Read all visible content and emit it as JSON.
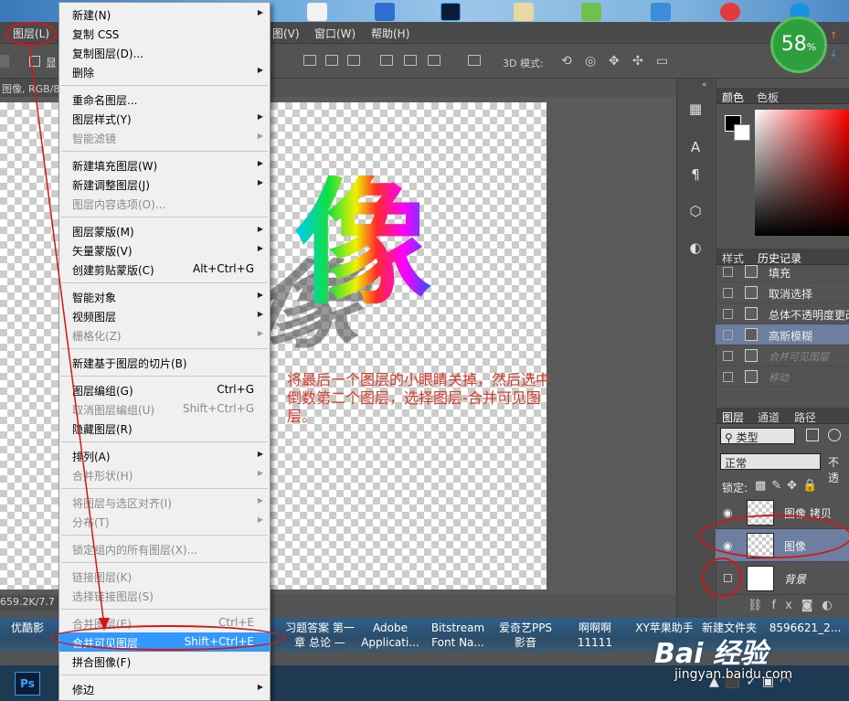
{
  "ps_menubar": {
    "layer": "图层(L)",
    "view": "图(V)",
    "window": "窗口(W)",
    "help": "帮助(H)"
  },
  "options_bar": {
    "mode_3d": "3D 模式:",
    "show": "显"
  },
  "document": {
    "tab": "图像, RGB/8)",
    "status": "659.2K/7.7"
  },
  "canvas": {
    "glyph": "像",
    "annotation": "将最后一个图层的小眼睛关掉，然后选中倒数第二个图层，选择图层-合并可见图层。"
  },
  "panels": {
    "color_tabs": [
      "颜色",
      "色板"
    ],
    "history_tabs": [
      "样式",
      "历史记录"
    ],
    "history": [
      {
        "label": "填充",
        "selected": false,
        "dimmed": false
      },
      {
        "label": "取消选择",
        "selected": false,
        "dimmed": false
      },
      {
        "label": "总体不透明度更改",
        "selected": false,
        "dimmed": false
      },
      {
        "label": "高斯模糊",
        "selected": true,
        "dimmed": false
      },
      {
        "label": "合并可见图层",
        "selected": false,
        "dimmed": true
      },
      {
        "label": "移动",
        "selected": false,
        "dimmed": true
      }
    ],
    "layer_tabs": [
      "图层",
      "通道",
      "路径"
    ],
    "filter_kind": "类型",
    "blend_mode": "正常",
    "opacity_label": "不透",
    "lock_label": "锁定:",
    "layers": [
      {
        "name": "图像 拷贝",
        "visible": true,
        "selected": false,
        "italic": false
      },
      {
        "name": "图像",
        "visible": true,
        "selected": true,
        "italic": false
      },
      {
        "name": "背景",
        "visible": false,
        "selected": false,
        "italic": true
      }
    ]
  },
  "layer_menu": {
    "items": [
      {
        "label": "新建(N)",
        "shortcut": "",
        "submenu": true,
        "disabled": false
      },
      {
        "label": "复制 CSS",
        "shortcut": "",
        "submenu": false,
        "disabled": false
      },
      {
        "label": "复制图层(D)...",
        "shortcut": "",
        "submenu": false,
        "disabled": false
      },
      {
        "label": "删除",
        "shortcut": "",
        "submenu": true,
        "disabled": false
      },
      {
        "label": "重命名图层...",
        "shortcut": "",
        "submenu": false,
        "disabled": false
      },
      {
        "label": "图层样式(Y)",
        "shortcut": "",
        "submenu": true,
        "disabled": false
      },
      {
        "label": "智能滤镜",
        "shortcut": "",
        "submenu": true,
        "disabled": true
      },
      {
        "label": "新建填充图层(W)",
        "shortcut": "",
        "submenu": true,
        "disabled": false
      },
      {
        "label": "新建调整图层(J)",
        "shortcut": "",
        "submenu": true,
        "disabled": false
      },
      {
        "label": "图层内容选项(O)...",
        "shortcut": "",
        "submenu": false,
        "disabled": true
      },
      {
        "label": "图层蒙版(M)",
        "shortcut": "",
        "submenu": true,
        "disabled": false
      },
      {
        "label": "矢量蒙版(V)",
        "shortcut": "",
        "submenu": true,
        "disabled": false
      },
      {
        "label": "创建剪贴蒙版(C)",
        "shortcut": "Alt+Ctrl+G",
        "submenu": false,
        "disabled": false
      },
      {
        "label": "智能对象",
        "shortcut": "",
        "submenu": true,
        "disabled": false
      },
      {
        "label": "视频图层",
        "shortcut": "",
        "submenu": true,
        "disabled": false
      },
      {
        "label": "栅格化(Z)",
        "shortcut": "",
        "submenu": true,
        "disabled": true
      },
      {
        "label": "新建基于图层的切片(B)",
        "shortcut": "",
        "submenu": false,
        "disabled": false
      },
      {
        "label": "图层编组(G)",
        "shortcut": "Ctrl+G",
        "submenu": false,
        "disabled": false
      },
      {
        "label": "取消图层编组(U)",
        "shortcut": "Shift+Ctrl+G",
        "submenu": false,
        "disabled": true
      },
      {
        "label": "隐藏图层(R)",
        "shortcut": "",
        "submenu": false,
        "disabled": false
      },
      {
        "label": "排列(A)",
        "shortcut": "",
        "submenu": true,
        "disabled": false
      },
      {
        "label": "合并形状(H)",
        "shortcut": "",
        "submenu": true,
        "disabled": true
      },
      {
        "label": "将图层与选区对齐(I)",
        "shortcut": "",
        "submenu": true,
        "disabled": true
      },
      {
        "label": "分布(T)",
        "shortcut": "",
        "submenu": true,
        "disabled": true
      },
      {
        "label": "锁定组内的所有图层(X)...",
        "shortcut": "",
        "submenu": false,
        "disabled": true
      },
      {
        "label": "链接图层(K)",
        "shortcut": "",
        "submenu": false,
        "disabled": true
      },
      {
        "label": "选择链接图层(S)",
        "shortcut": "",
        "submenu": false,
        "disabled": true
      },
      {
        "label": "合并图层(E)",
        "shortcut": "Ctrl+E",
        "submenu": false,
        "disabled": true
      },
      {
        "label": "合并可见图层",
        "shortcut": "Shift+Ctrl+E",
        "submenu": false,
        "disabled": false,
        "highlighted": true
      },
      {
        "label": "拼合图像(F)",
        "shortcut": "",
        "submenu": false,
        "disabled": false
      },
      {
        "label": "修边",
        "shortcut": "",
        "submenu": true,
        "disabled": false
      }
    ]
  },
  "taskbar_labels": [
    "优酷影",
    "习题答案 第一章 总论 —",
    "Adobe Applicati...",
    "Bitstream Font Na...",
    "爱奇艺PPS 影音",
    "啊啊啊11111",
    "XY苹果助手",
    "新建文件夹",
    "8596621_2..."
  ],
  "speed_badge": {
    "value": "58",
    "unit": "%"
  },
  "watermark": {
    "logo": "Bai 经验",
    "url": "jingyan.baidu.com"
  },
  "taskbar": {
    "ps_icon": "Ps"
  },
  "colors": {
    "annotation_red": "#d01818",
    "menu_highlight": "#3399ff",
    "layer_selected": "#6d7fa0"
  }
}
